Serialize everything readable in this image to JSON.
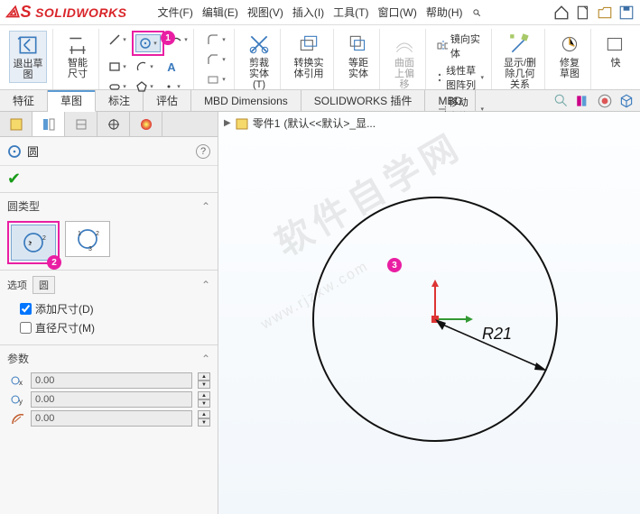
{
  "app": {
    "name": "SOLIDWORKS"
  },
  "menus": [
    "文件(F)",
    "编辑(E)",
    "视图(V)",
    "插入(I)",
    "工具(T)",
    "窗口(W)",
    "帮助(H)"
  ],
  "titlebar_icons": [
    "home-icon",
    "new-icon",
    "open-icon",
    "save-icon"
  ],
  "ribbon": {
    "exit_sketch": "退出草图",
    "smart_dim": "智能尺寸",
    "trim": "剪裁实体(T)",
    "convert": "转换实体引用",
    "offset": "等距实体",
    "surface_offset": "曲面上偏移",
    "mirror": "镜向实体",
    "linear_pattern": "线性草图阵列",
    "move": "移动实体",
    "show_rel": "显示/删除几何关系",
    "repair": "修复草图",
    "quick": "快"
  },
  "tabs": [
    "特征",
    "草图",
    "标注",
    "评估",
    "MBD Dimensions",
    "SOLIDWORKS 插件",
    "MBD"
  ],
  "active_tab": 1,
  "breadcrumb": {
    "part": "零件1",
    "config": "(默认<<默认>_显..."
  },
  "pm": {
    "title": "圆",
    "sec_circle_type": "圆类型",
    "sec_options": "选项",
    "opt_circle": "圆",
    "add_dim": "添加尺寸(D)",
    "dia_dim": "直径尺寸(M)",
    "sec_params": "参数",
    "params": [
      {
        "icon": "cx",
        "value": "0.00"
      },
      {
        "icon": "cy",
        "value": "0.00"
      },
      {
        "icon": "r",
        "value": "0.00"
      }
    ]
  },
  "chart_data": {
    "type": "sketch-circle",
    "radius_label": "R21",
    "radius": 21,
    "center": [
      0,
      0
    ],
    "annotations": [
      {
        "id": "3",
        "type": "point-badge",
        "pos": "on-circle"
      }
    ]
  },
  "colors": {
    "accent": "#e91ea3",
    "sw_red": "#d9252a",
    "blue": "#5b9bd5"
  }
}
